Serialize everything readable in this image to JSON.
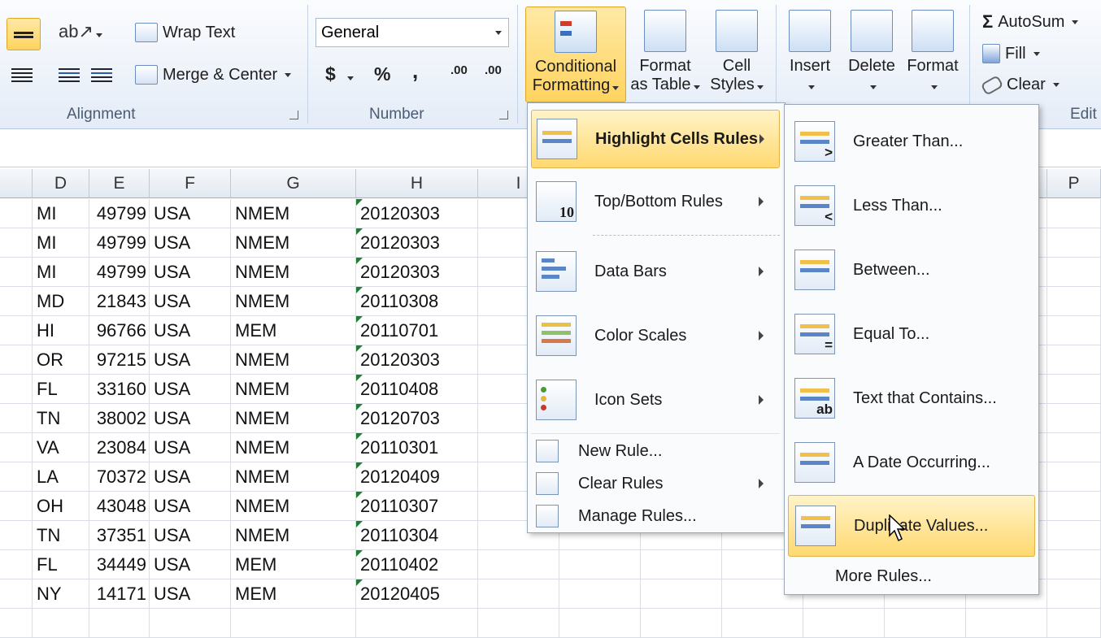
{
  "ribbon": {
    "alignment": {
      "wrap_text": "Wrap Text",
      "merge_center": "Merge & Center",
      "label": "Alignment"
    },
    "number": {
      "format": "General",
      "currency": "$",
      "percent": "%",
      "comma": ",",
      "inc_decimal": ".00",
      "dec_decimal": ".00",
      "label": "Number"
    },
    "styles": {
      "conditional_formatting": [
        "Conditional",
        "Formatting"
      ],
      "format_as_table": [
        "Format",
        "as Table"
      ],
      "cell_styles": [
        "Cell",
        "Styles"
      ]
    },
    "cells": {
      "insert": "Insert",
      "delete": "Delete",
      "format": "Format"
    },
    "editing": {
      "autosum": "AutoSum",
      "fill": "Fill",
      "clear": "Clear",
      "label": "Edit"
    }
  },
  "columns": [
    "D",
    "E",
    "F",
    "G",
    "H",
    "I",
    "P"
  ],
  "rows": [
    [
      "MI",
      "49799",
      "USA",
      "NMEM",
      "20120303"
    ],
    [
      "MI",
      "49799",
      "USA",
      "NMEM",
      "20120303"
    ],
    [
      "MI",
      "49799",
      "USA",
      "NMEM",
      "20120303"
    ],
    [
      "MD",
      "21843",
      "USA",
      "NMEM",
      "20110308"
    ],
    [
      "HI",
      "96766",
      "USA",
      "MEM",
      "20110701"
    ],
    [
      "OR",
      "97215",
      "USA",
      "NMEM",
      "20120303"
    ],
    [
      "FL",
      "33160",
      "USA",
      "NMEM",
      "20110408"
    ],
    [
      "TN",
      "38002",
      "USA",
      "NMEM",
      "20120703"
    ],
    [
      "VA",
      "23084",
      "USA",
      "NMEM",
      "20110301"
    ],
    [
      "LA",
      "70372",
      "USA",
      "NMEM",
      "20120409"
    ],
    [
      "OH",
      "43048",
      "USA",
      "NMEM",
      "20110307"
    ],
    [
      "TN",
      "37351",
      "USA",
      "NMEM",
      "20110304"
    ],
    [
      "FL",
      "34449",
      "USA",
      "MEM",
      "20110402"
    ],
    [
      "NY",
      "14171",
      "USA",
      "MEM",
      "20120405"
    ]
  ],
  "cf_menu": {
    "items": [
      "Highlight Cells Rules",
      "Top/Bottom Rules",
      "Data Bars",
      "Color Scales",
      "Icon Sets"
    ],
    "top_bottom_icon_text": "10",
    "small_items": [
      "New Rule...",
      "Clear Rules",
      "Manage Rules..."
    ]
  },
  "submenu": {
    "items": [
      "Greater Than...",
      "Less Than...",
      "Between...",
      "Equal To...",
      "Text that Contains...",
      "A Date Occurring...",
      "Duplicate Values..."
    ],
    "icon_glyphs": [
      ">",
      "<",
      "",
      "=",
      "ab",
      "",
      ""
    ],
    "more": "More Rules..."
  }
}
